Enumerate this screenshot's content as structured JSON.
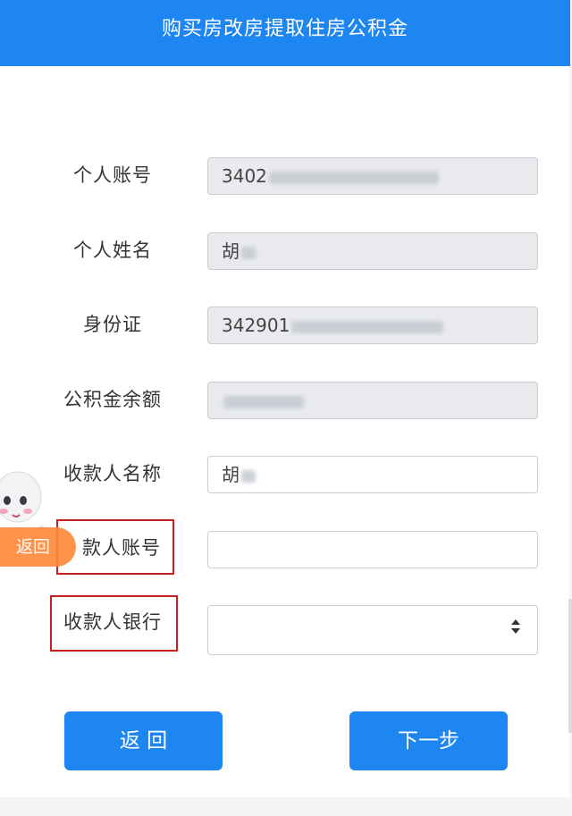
{
  "header": {
    "title": "购买房改房提取住房公积金"
  },
  "form": {
    "personal_account": {
      "label": "个人账号",
      "value": "3402"
    },
    "personal_name": {
      "label": "个人姓名",
      "value": "胡"
    },
    "id_card": {
      "label": "身份证",
      "value": "342901"
    },
    "balance": {
      "label": "公积金余额",
      "value": ""
    },
    "payee_name": {
      "label": "收款人名称",
      "value": "胡"
    },
    "payee_account": {
      "label": "款人账号",
      "value": ""
    },
    "payee_bank": {
      "label": "收款人银行",
      "value": ""
    }
  },
  "floating": {
    "return_label": "返回"
  },
  "buttons": {
    "back": "返 回",
    "next": "下一步"
  },
  "colors": {
    "primary": "#1e86f0",
    "highlight": "#c82020",
    "float": "#ff8a3c"
  }
}
